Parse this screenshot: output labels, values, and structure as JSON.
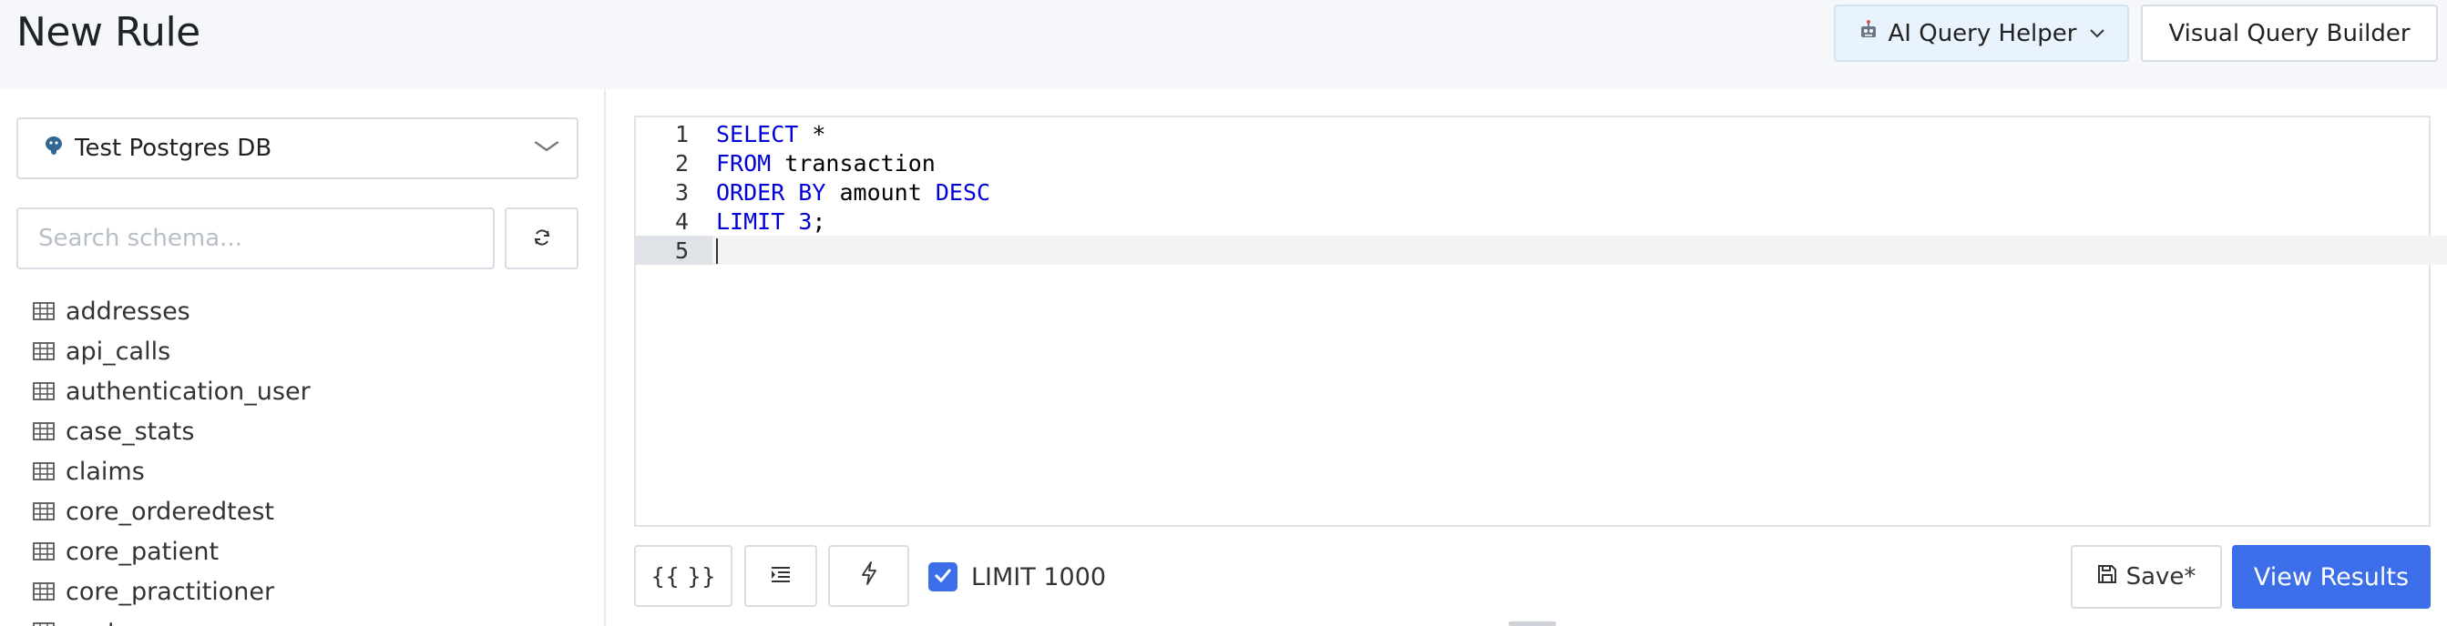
{
  "header": {
    "title": "New Rule",
    "ai_helper_label": "AI Query Helper",
    "visual_builder_label": "Visual Query Builder"
  },
  "sidebar": {
    "database": "Test Postgres DB",
    "search_placeholder": "Search schema...",
    "tables": [
      "addresses",
      "api_calls",
      "authentication_user",
      "case_stats",
      "claims",
      "core_orderedtest",
      "core_patient",
      "core_practitioner",
      "cust..."
    ]
  },
  "editor": {
    "lines": [
      {
        "num": "1",
        "tokens": [
          {
            "t": "SELECT",
            "kw": true
          },
          {
            "t": " *",
            "kw": false
          }
        ]
      },
      {
        "num": "2",
        "tokens": [
          {
            "t": "FROM",
            "kw": true
          },
          {
            "t": " transaction",
            "kw": false
          }
        ]
      },
      {
        "num": "3",
        "tokens": [
          {
            "t": "ORDER BY",
            "kw": true
          },
          {
            "t": " amount ",
            "kw": false
          },
          {
            "t": "DESC",
            "kw": true
          }
        ]
      },
      {
        "num": "4",
        "tokens": [
          {
            "t": "LIMIT",
            "kw": true
          },
          {
            "t": " ",
            "kw": false
          },
          {
            "t": "3",
            "kw": true
          },
          {
            "t": ";",
            "kw": false
          }
        ]
      },
      {
        "num": "5",
        "tokens": []
      }
    ],
    "active_line": 5
  },
  "toolbar": {
    "template_label": "{{ }}",
    "limit_label": "LIMIT 1000",
    "limit_checked": true,
    "save_label": "Save*",
    "view_results_label": "View Results"
  },
  "colors": {
    "primary": "#3b6ee8",
    "keyword": "#0000d6"
  }
}
